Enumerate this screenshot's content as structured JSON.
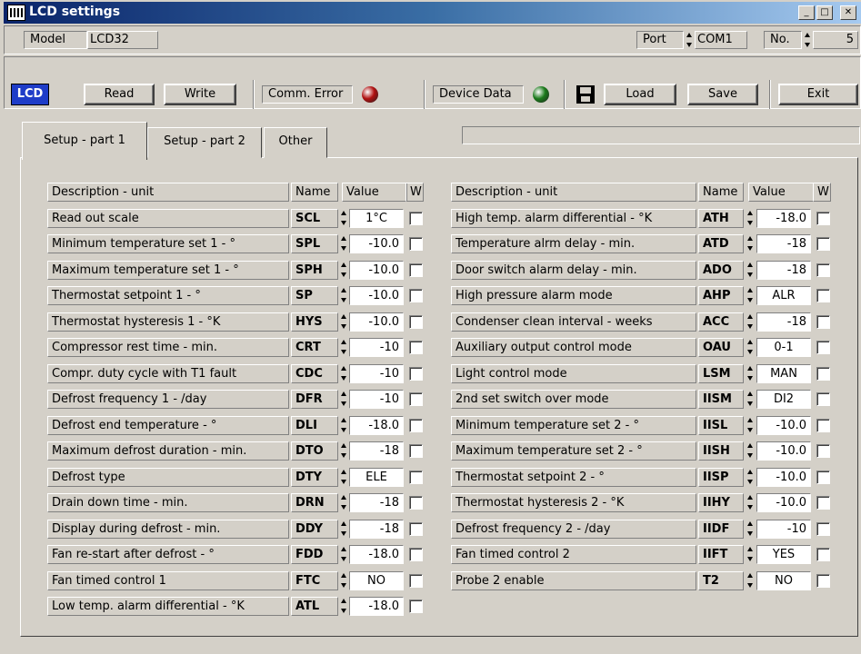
{
  "window": {
    "title": "LCD settings"
  },
  "header": {
    "model_label": "Model",
    "model_value": "LCD32",
    "port_label": "Port",
    "port_value": "COM1",
    "no_label": "No.",
    "no_value": "5"
  },
  "toolbar": {
    "lcd": "LCD",
    "read": "Read",
    "write": "Write",
    "comm_error": "Comm. Error",
    "device_data": "Device Data",
    "load": "Load",
    "save": "Save",
    "exit": "Exit",
    "comm_led_color": "#b01010",
    "device_led_color": "#1a7a1a"
  },
  "tabs": [
    {
      "label": "Setup - part 1"
    },
    {
      "label": "Setup - part 2"
    },
    {
      "label": "Other"
    }
  ],
  "columns": {
    "desc": "Description - unit",
    "name": "Name",
    "value": "Value",
    "w": "W"
  },
  "left": [
    {
      "desc": "Read out scale",
      "name": "SCL",
      "value": "1°C"
    },
    {
      "desc": "Minimum temperature set 1 - °",
      "name": "SPL",
      "value": "-10.0"
    },
    {
      "desc": "Maximum temperature set 1 - °",
      "name": "SPH",
      "value": "-10.0"
    },
    {
      "desc": "Thermostat setpoint 1 - °",
      "name": "SP",
      "value": "-10.0"
    },
    {
      "desc": "Thermostat hysteresis 1 - °K",
      "name": "HYS",
      "value": "-10.0"
    },
    {
      "desc": "Compressor rest time - min.",
      "name": "CRT",
      "value": "-10"
    },
    {
      "desc": "Compr. duty cycle with T1 fault",
      "name": "CDC",
      "value": "-10"
    },
    {
      "desc": "Defrost frequency 1 - /day",
      "name": "DFR",
      "value": "-10"
    },
    {
      "desc": "Defrost end temperature - °",
      "name": "DLI",
      "value": "-18.0"
    },
    {
      "desc": "Maximum defrost duration - min.",
      "name": "DTO",
      "value": "-18"
    },
    {
      "desc": "Defrost type",
      "name": "DTY",
      "value": "ELE"
    },
    {
      "desc": "Drain down time - min.",
      "name": "DRN",
      "value": "-18"
    },
    {
      "desc": "Display during defrost - min.",
      "name": "DDY",
      "value": "-18"
    },
    {
      "desc": "Fan re-start after defrost - °",
      "name": "FDD",
      "value": "-18.0"
    },
    {
      "desc": "Fan timed control 1",
      "name": "FTC",
      "value": "NO"
    },
    {
      "desc": "Low temp. alarm differential - °K",
      "name": "ATL",
      "value": "-18.0"
    }
  ],
  "right": [
    {
      "desc": "High temp. alarm differential - °K",
      "name": "ATH",
      "value": "-18.0"
    },
    {
      "desc": "Temperature alrm delay - min.",
      "name": "ATD",
      "value": "-18"
    },
    {
      "desc": "Door switch alarm delay - min.",
      "name": "ADO",
      "value": "-18"
    },
    {
      "desc": "High pressure alarm mode",
      "name": "AHP",
      "value": "ALR"
    },
    {
      "desc": "Condenser clean interval - weeks",
      "name": "ACC",
      "value": "-18"
    },
    {
      "desc": "Auxiliary output control mode",
      "name": "OAU",
      "value": "0-1"
    },
    {
      "desc": "Light control mode",
      "name": "LSM",
      "value": "MAN"
    },
    {
      "desc": "2nd set switch over mode",
      "name": "IISM",
      "value": "DI2"
    },
    {
      "desc": "Minimum temperature set 2 - °",
      "name": "IISL",
      "value": "-10.0"
    },
    {
      "desc": "Maximum temperature set 2 - °",
      "name": "IISH",
      "value": "-10.0"
    },
    {
      "desc": "Thermostat setpoint 2 - °",
      "name": "IISP",
      "value": "-10.0"
    },
    {
      "desc": "Thermostat hysteresis 2 - °K",
      "name": "IIHY",
      "value": "-10.0"
    },
    {
      "desc": "Defrost frequency 2 - /day",
      "name": "IIDF",
      "value": "-10"
    },
    {
      "desc": "Fan timed control 2",
      "name": "IIFT",
      "value": "YES"
    },
    {
      "desc": "Probe 2 enable",
      "name": "T2",
      "value": "NO"
    }
  ]
}
